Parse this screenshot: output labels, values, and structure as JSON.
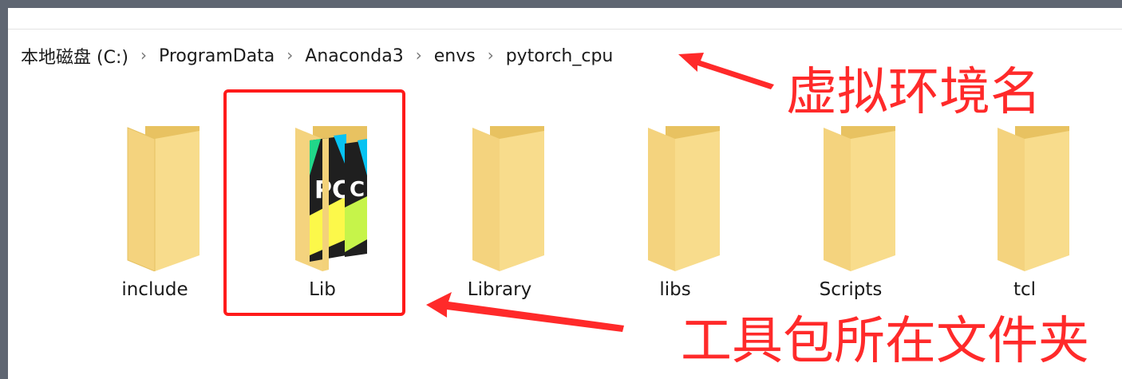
{
  "breadcrumb": {
    "items": [
      "本地磁盘 (C:)",
      "ProgramData",
      "Anaconda3",
      "envs",
      "pytorch_cpu"
    ],
    "separator": "›"
  },
  "folders": [
    {
      "name": "include",
      "icon": "folder-icon"
    },
    {
      "name": "Lib",
      "icon": "folder-with-pycharm-files-icon"
    },
    {
      "name": "Library",
      "icon": "folder-icon"
    },
    {
      "name": "libs",
      "icon": "folder-icon"
    },
    {
      "name": "Scripts",
      "icon": "folder-icon"
    },
    {
      "name": "tcl",
      "icon": "folder-icon"
    }
  ],
  "annotations": {
    "env_name": "虚拟环境名",
    "toolkit_folder": "工具包所在文件夹",
    "color": "#ff2a2a"
  }
}
